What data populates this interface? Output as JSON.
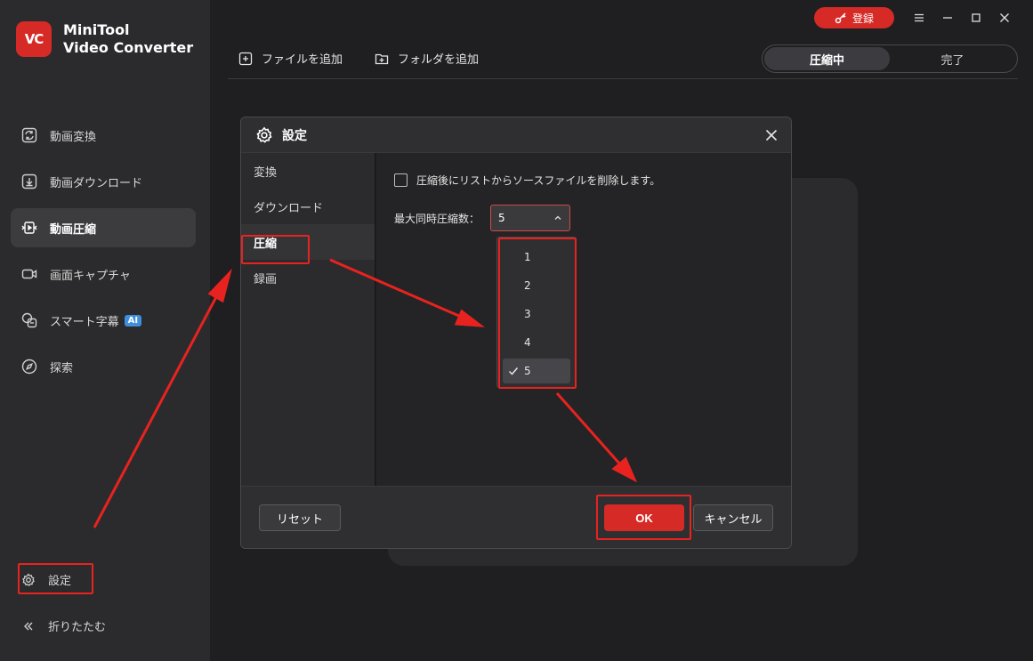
{
  "app": {
    "logo_text": "VC",
    "name_line1": "MiniTool",
    "name_line2": "Video Converter"
  },
  "titlebar": {
    "register_label": "登録"
  },
  "sidebar": {
    "items": [
      {
        "label": "動画変換",
        "icon": "convert-icon"
      },
      {
        "label": "動画ダウンロード",
        "icon": "download-icon"
      },
      {
        "label": "動画圧縮",
        "icon": "compress-icon",
        "active": true
      },
      {
        "label": "画面キャプチャ",
        "icon": "camera-icon"
      },
      {
        "label": "スマート字幕",
        "icon": "subtitle-icon",
        "badge": "AI"
      },
      {
        "label": "探索",
        "icon": "compass-icon"
      }
    ],
    "settings_label": "設定",
    "collapse_label": "折りたたむ"
  },
  "toolbar": {
    "add_file_label": "ファイルを追加",
    "add_folder_label": "フォルダを追加"
  },
  "tabs": {
    "compressing": "圧縮中",
    "done": "完了"
  },
  "dialog": {
    "title": "設定",
    "side_items": [
      "変換",
      "ダウンロード",
      "圧縮",
      "録画"
    ],
    "active_side_index": 2,
    "delete_source_label": "圧縮後にリストからソースファイルを削除します。",
    "delete_source_checked": false,
    "max_concurrent_label": "最大同時圧縮数：",
    "max_concurrent_value": "5",
    "options": [
      "1",
      "2",
      "3",
      "4",
      "5"
    ],
    "selected_option": "5",
    "reset_label": "リセット",
    "ok_label": "OK",
    "cancel_label": "キャンセル"
  },
  "colors": {
    "accent": "#d62a26",
    "annotation": "#e8231f",
    "sidebar_bg": "#2b2b2d",
    "main_bg": "#1f1f21"
  }
}
